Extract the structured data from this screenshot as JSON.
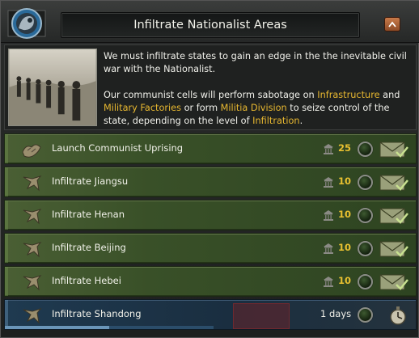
{
  "panel": {
    "title": "Infiltrate Nationalist Areas",
    "description": {
      "p1": "We must infiltrate states to gain an edge in the the inevitable civil war with the Nationalist.",
      "p2_a": "Our communist cells will perform sabotage on ",
      "p2_infrastructure": "Infrastructure",
      "p2_b": " and ",
      "p2_military": "Military Factories",
      "p2_c": " or form ",
      "p2_militia": "Militia Division",
      "p2_d": " to seize control of the state, depending on the level of ",
      "p2_infiltration": "Infiltration",
      "p2_e": "."
    }
  },
  "colors": {
    "highlight": "#e8b830",
    "row_green": "#395028",
    "row_active_blue": "#1a2e40",
    "cost_gold": "#e8c030"
  },
  "decisions": [
    {
      "label": "Launch Communist Uprising",
      "cost": "25",
      "icon": "uprising-icon",
      "action_icon": "envelope-check-icon"
    },
    {
      "label": "Infiltrate Jiangsu",
      "cost": "10",
      "icon": "infiltrate-icon",
      "action_icon": "envelope-check-icon"
    },
    {
      "label": "Infiltrate Henan",
      "cost": "10",
      "icon": "infiltrate-icon",
      "action_icon": "envelope-check-icon"
    },
    {
      "label": "Infiltrate Beijing",
      "cost": "10",
      "icon": "infiltrate-icon",
      "action_icon": "envelope-check-icon"
    },
    {
      "label": "Infiltrate Hebei",
      "cost": "10",
      "icon": "infiltrate-icon",
      "action_icon": "envelope-check-icon"
    }
  ],
  "active_decision": {
    "label": "Infiltrate Shandong",
    "remaining": "1 days",
    "progress": 0.5,
    "icon": "infiltrate-icon",
    "action_icon": "stopwatch-icon"
  }
}
